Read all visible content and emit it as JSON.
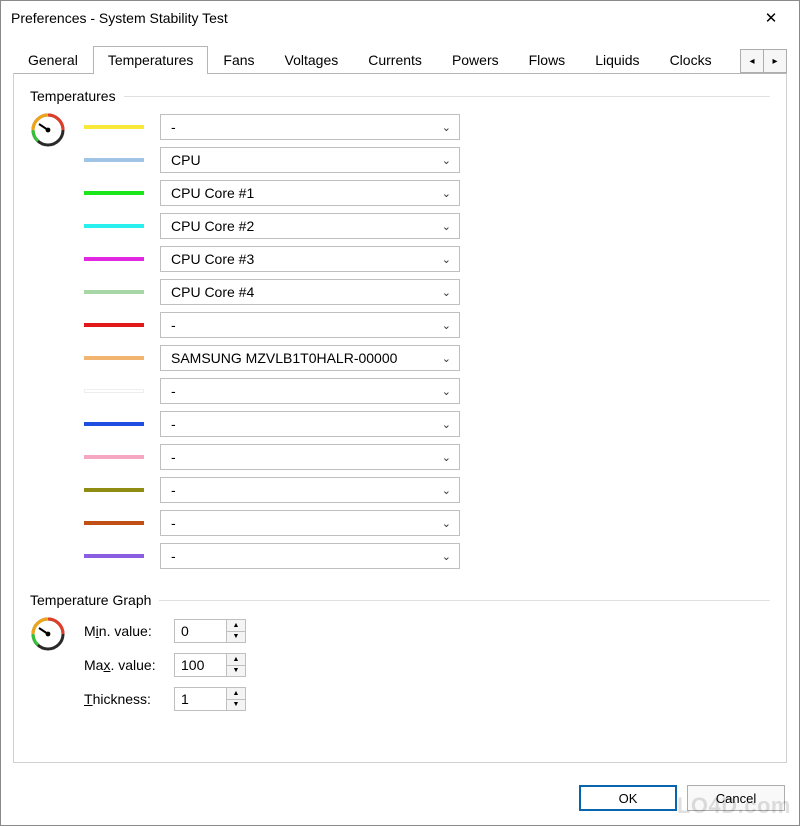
{
  "window": {
    "title": "Preferences - System Stability Test",
    "close_glyph": "✕"
  },
  "tabs": {
    "items": [
      "General",
      "Temperatures",
      "Fans",
      "Voltages",
      "Currents",
      "Powers",
      "Flows",
      "Liquids",
      "Clocks"
    ],
    "active_index": 1,
    "scroll_left_glyph": "◂",
    "scroll_right_glyph": "▸"
  },
  "section_temp": {
    "title": "Temperatures",
    "items": [
      {
        "color": "#f7e83a",
        "value": "-"
      },
      {
        "color": "#9fc4e6",
        "value": "CPU"
      },
      {
        "color": "#1ae61a",
        "value": "CPU Core #1"
      },
      {
        "color": "#27f0ef",
        "value": "CPU Core #2"
      },
      {
        "color": "#e227e2",
        "value": "CPU Core #3"
      },
      {
        "color": "#a7d6a7",
        "value": "CPU Core #4"
      },
      {
        "color": "#e11919",
        "value": "-"
      },
      {
        "color": "#f1b56f",
        "value": "SAMSUNG MZVLB1T0HALR-00000"
      },
      {
        "color": "#ffffff",
        "value": "-"
      },
      {
        "color": "#1d4ee0",
        "value": "-"
      },
      {
        "color": "#f5a7c2",
        "value": "-"
      },
      {
        "color": "#8e8d12",
        "value": "-"
      },
      {
        "color": "#c05015",
        "value": "-"
      },
      {
        "color": "#8a5ee0",
        "value": "-"
      }
    ]
  },
  "section_graph": {
    "title": "Temperature Graph",
    "min_label_pre": "M",
    "min_label_ul": "i",
    "min_label_post": "n. value:",
    "max_label_pre": "Ma",
    "max_label_ul": "x",
    "max_label_post": ". value:",
    "thk_label_ul": "T",
    "thk_label_post": "hickness:",
    "min_value": "0",
    "max_value": "100",
    "thickness": "1"
  },
  "footer": {
    "ok": "OK",
    "cancel": "Cancel"
  },
  "watermark": "LO4D.com"
}
